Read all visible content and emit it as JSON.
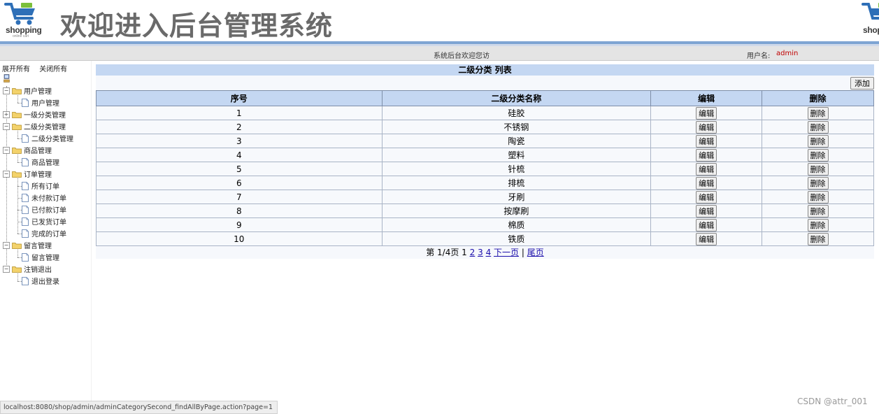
{
  "header": {
    "logo_text": "shopping",
    "logo_sub": "online cart",
    "title": "欢迎进入后台管理系统"
  },
  "infobar": {
    "welcome": "系统后台欢迎您访",
    "user_label": "用户名:",
    "user_name": "admin"
  },
  "sidebar": {
    "expand_all": "展开所有",
    "collapse_all": "关闭所有",
    "tree": [
      {
        "label": "用户管理",
        "children": [
          "用户管理"
        ]
      },
      {
        "label": "一级分类管理",
        "children": []
      },
      {
        "label": "二级分类管理",
        "children": [
          "二级分类管理"
        ]
      },
      {
        "label": "商品管理",
        "children": [
          "商品管理"
        ]
      },
      {
        "label": "订单管理",
        "children": [
          "所有订单",
          "未付款订单",
          "已付款订单",
          "已发货订单",
          "完成的订单"
        ]
      },
      {
        "label": "留言管理",
        "children": [
          "留言管理"
        ]
      },
      {
        "label": "注销退出",
        "children": [
          "退出登录"
        ]
      }
    ]
  },
  "content": {
    "title": "二级分类 列表",
    "add_label": "添加",
    "columns": [
      "序号",
      "二级分类名称",
      "编辑",
      "删除"
    ],
    "edit_label": "编辑",
    "delete_label": "删除",
    "rows": [
      {
        "no": "1",
        "name": "硅胶"
      },
      {
        "no": "2",
        "name": "不锈钢"
      },
      {
        "no": "3",
        "name": "陶瓷"
      },
      {
        "no": "4",
        "name": "塑料"
      },
      {
        "no": "5",
        "name": "针梳"
      },
      {
        "no": "6",
        "name": "排梳"
      },
      {
        "no": "7",
        "name": "牙刷"
      },
      {
        "no": "8",
        "name": "按摩刷"
      },
      {
        "no": "9",
        "name": "棉质"
      },
      {
        "no": "10",
        "name": "铁质"
      }
    ],
    "pager": {
      "prefix": "第 1/4页 1",
      "pages": [
        "2",
        "3",
        "4"
      ],
      "next": "下一页",
      "separator": "|",
      "last": "尾页"
    }
  },
  "statusbar": "localhost:8080/shop/admin/adminCategorySecond_findAllByPage.action?page=1",
  "watermark": "CSDN @attr_001",
  "colors": {
    "header_bg": "#c4d7f2",
    "top_rule": "#7ea4d3",
    "user_name": "#c00000",
    "link": "#1a0dab"
  }
}
